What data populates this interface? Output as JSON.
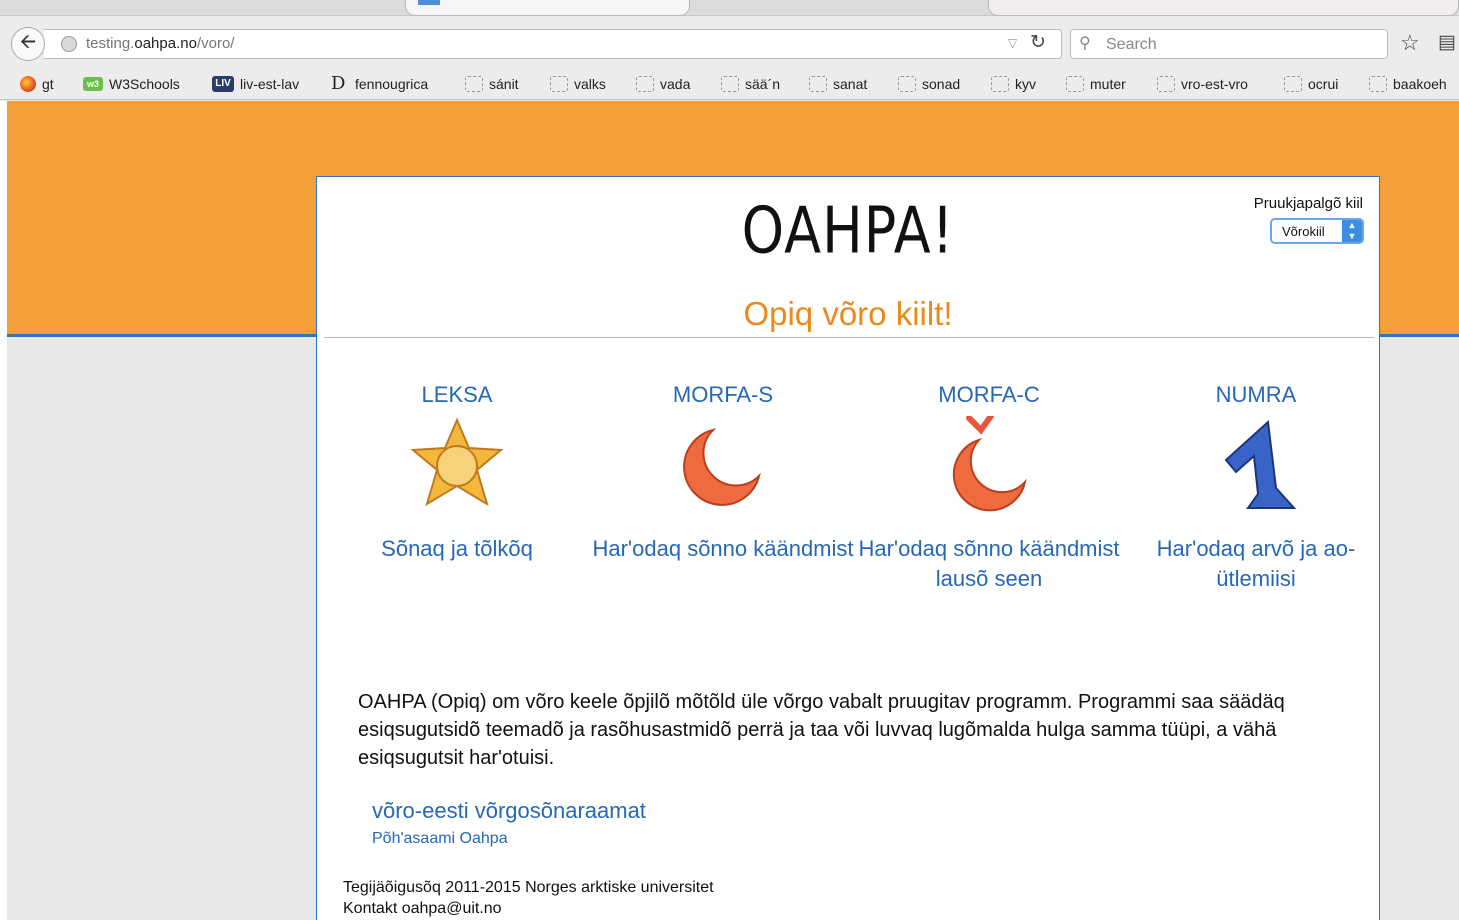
{
  "browser": {
    "url_prefix": "testing.",
    "url_domain": "oahpa.no",
    "url_path": "/voro/",
    "search_placeholder": "Search",
    "bookmarks": [
      "gt",
      "W3Schools",
      "liv-est-lav",
      "fennougrica",
      "sánit",
      "valks",
      "vada",
      "sää´n",
      "sanat",
      "sonad",
      "kyv",
      "muter",
      "vro-est-vro",
      "ocrui",
      "baakoeh"
    ]
  },
  "page": {
    "language_label": "Pruukjapalgõ kiil",
    "language_selected": "Võrokiil",
    "logo": "OAHPA!",
    "tagline": "Opiq võro kiilt!",
    "games": [
      {
        "title": "LEKSA",
        "description": "Sõnaq ja tõlkõq",
        "icon": "sun-star-icon"
      },
      {
        "title": "MORFA-S",
        "description": "Har'odaq sõnno käändmist",
        "icon": "crescent-icon"
      },
      {
        "title": "MORFA-C",
        "description": "Har'odaq sõnno käändmist lausõ seen",
        "icon": "crescent-caron-icon"
      },
      {
        "title": "NUMRA",
        "description": "Har'odaq arvõ ja ao-ütlemiisi",
        "icon": "number-one-icon"
      }
    ],
    "intro": "OAHPA (Opiq) om võro keele õpjilõ mõtõld üle võrgo vabalt pruugitav programm. Programmi saa säädäq esiqsugutsidõ teemadõ ja rasõhusastmidõ perrä ja taa või luvvaq lugõmalda hulga samma tüüpi, a vähä esiqsugutsit har'otuisi.",
    "dictionary_link": "võro-eesti võrgosõnaraamat",
    "sami_link": "Põh'asaami Oahpa",
    "copyright": "Tegijäõigusõq 2011-2015 Norges arktiske universitet",
    "contact": "Kontakt oahpa@uit.no"
  },
  "colors": {
    "orange": "#f4a03a",
    "link_blue": "#2668b5",
    "tagline_orange": "#ea8a18"
  }
}
